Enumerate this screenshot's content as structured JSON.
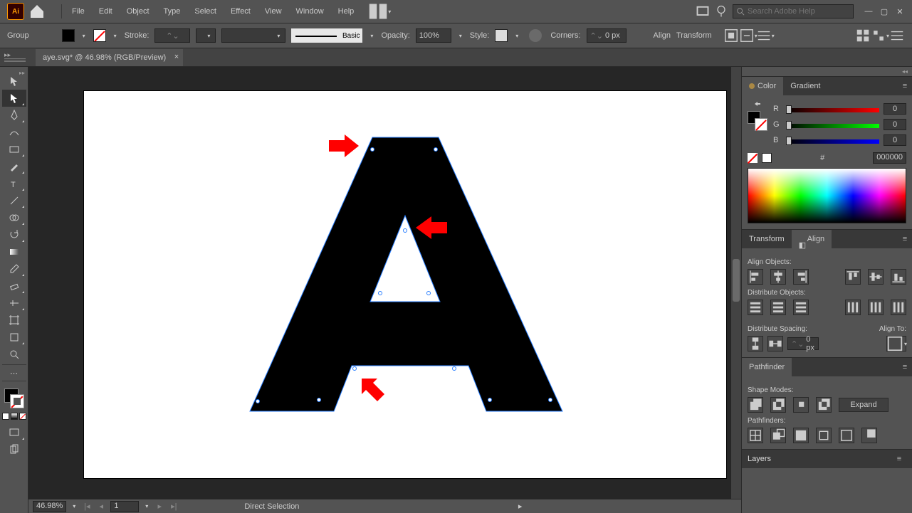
{
  "menu": {
    "items": [
      "File",
      "Edit",
      "Object",
      "Type",
      "Select",
      "Effect",
      "View",
      "Window",
      "Help"
    ],
    "search_placeholder": "Search Adobe Help"
  },
  "control": {
    "selection_label": "Group",
    "stroke_label": "Stroke:",
    "brush_label": "Basic",
    "opacity_label": "Opacity:",
    "opacity_value": "100%",
    "style_label": "Style:",
    "corners_label": "Corners:",
    "corners_value": "0 px",
    "align_label": "Align",
    "transform_label": "Transform"
  },
  "tab": {
    "title": "aye.svg* @ 46.98% (RGB/Preview)"
  },
  "status": {
    "zoom": "46.98%",
    "page": "1",
    "tool_name": "Direct Selection"
  },
  "color_panel": {
    "tabs": [
      "Color",
      "Gradient"
    ],
    "r": "0",
    "g": "0",
    "b": "0",
    "hex": "000000",
    "hash": "#"
  },
  "transform_panel": {
    "tabs": [
      "Transform",
      "Align"
    ],
    "sections": {
      "align_objects": "Align Objects:",
      "distribute_objects": "Distribute Objects:",
      "distribute_spacing": "Distribute Spacing:",
      "align_to": "Align To:"
    },
    "space_value": "0 px"
  },
  "pathfinder": {
    "title": "Pathfinder",
    "shape_modes": "Shape Modes:",
    "expand": "Expand",
    "pathfinders": "Pathfinders:"
  },
  "layers": {
    "title": "Layers"
  }
}
